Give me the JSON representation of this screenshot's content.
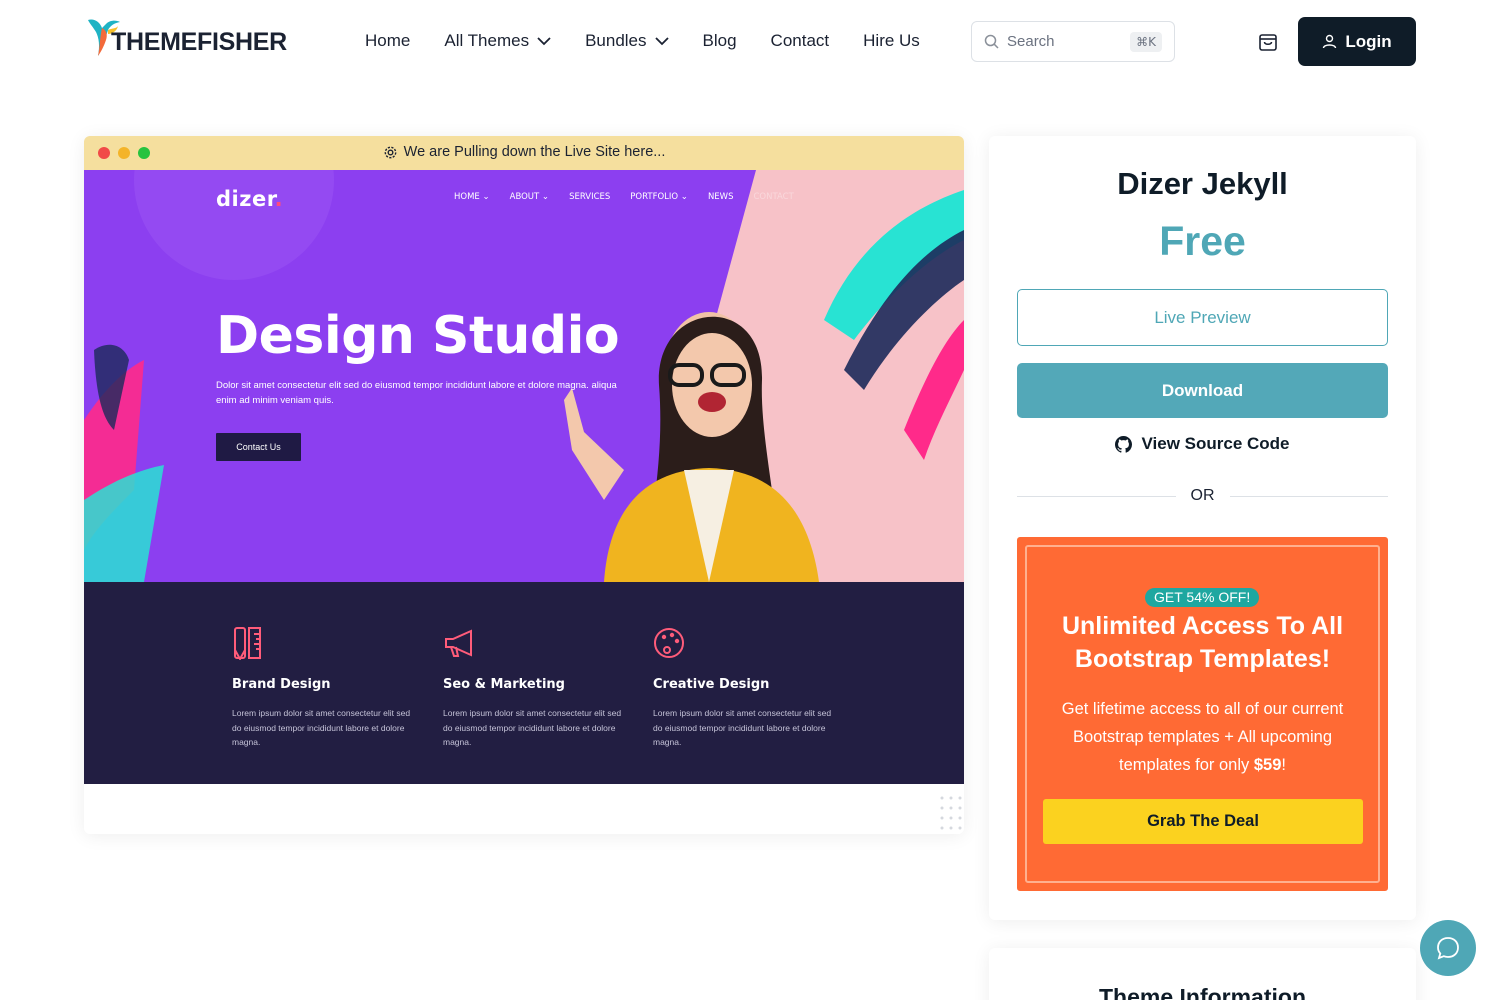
{
  "header": {
    "logo_text": "THEMEFISHER",
    "nav": [
      {
        "label": "Home",
        "dropdown": false
      },
      {
        "label": "All Themes",
        "dropdown": true
      },
      {
        "label": "Bundles",
        "dropdown": true
      },
      {
        "label": "Blog",
        "dropdown": false
      },
      {
        "label": "Contact",
        "dropdown": false
      },
      {
        "label": "Hire Us",
        "dropdown": false
      }
    ],
    "search": {
      "placeholder": "Search",
      "shortcut": "⌘K"
    },
    "login_label": "Login"
  },
  "preview": {
    "bar_message": "We are Pulling down the Live Site here...",
    "site": {
      "logo": "dizer",
      "logo_dot": ".",
      "nav": [
        "HOME ⌄",
        "ABOUT ⌄",
        "SERVICES",
        "PORTFOLIO ⌄",
        "NEWS",
        "CONTACT"
      ],
      "hero_title": "Design Studio",
      "hero_sub": "Dolor sit amet consectetur elit sed do eiusmod tempor incididunt labore et dolore magna. aliqua enim ad minim veniam quis.",
      "hero_button": "Contact Us",
      "services": [
        {
          "title": "Brand Design",
          "text": "Lorem ipsum dolor sit amet consectetur elit sed do eiusmod tempor incididunt labore et dolore magna."
        },
        {
          "title": "Seo & Marketing",
          "text": "Lorem ipsum dolor sit amet consectetur elit sed do eiusmod tempor incididunt labore et dolore magna."
        },
        {
          "title": "Creative Design",
          "text": "Lorem ipsum dolor sit amet consectetur elit sed do eiusmod tempor incididunt labore et dolore magna."
        }
      ]
    }
  },
  "sidebar": {
    "title": "Dizer Jekyll",
    "price": "Free",
    "live_preview_label": "Live Preview",
    "download_label": "Download",
    "source_label": "View Source Code",
    "or_label": "OR",
    "deal": {
      "badge": "GET 54% OFF!",
      "title_line1": "Unlimited Access To All",
      "title_line2": "Bootstrap Templates!",
      "text_before": "Get lifetime access to all of our current Bootstrap templates + All upcoming templates for only ",
      "price": "$59",
      "text_after": "!",
      "button_label": "Grab The Deal"
    },
    "info_title": "Theme Information"
  },
  "colors": {
    "accent": "#4fa7b6",
    "dark": "#0f1c28",
    "deal_bg": "#ff6a34",
    "deal_button": "#fbd21f",
    "badge": "#1fa7a0",
    "hero_purple": "#8c3ff0",
    "services_bg": "#221e42"
  }
}
